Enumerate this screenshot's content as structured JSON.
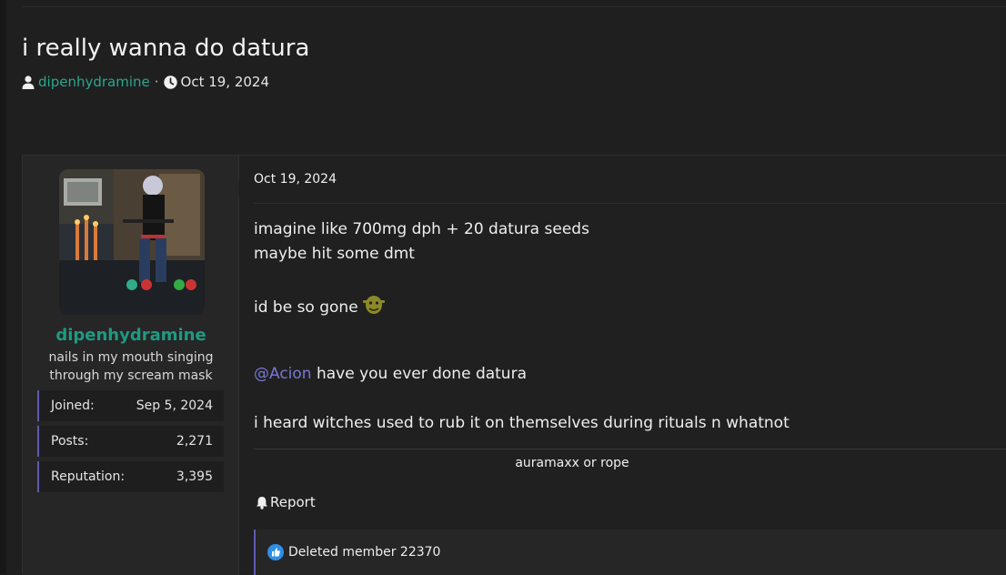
{
  "thread": {
    "title": "i really wanna do datura",
    "author": "dipenhydramine",
    "separator": "·",
    "date": "Oct 19, 2024",
    "icons": {
      "author": "user-icon",
      "date": "clock-icon"
    }
  },
  "post": {
    "user": {
      "username": "dipenhydramine",
      "title": "nails in my mouth singing through my scream mask",
      "avatar": "avatar",
      "stats": [
        {
          "label": "Joined:",
          "value": "Sep 5, 2024"
        },
        {
          "label": "Posts:",
          "value": "2,271"
        },
        {
          "label": "Reputation:",
          "value": "3,395"
        }
      ]
    },
    "date": "Oct 19, 2024",
    "body": {
      "line1": "imagine like 700mg dph + 20 datura seeds",
      "line2": "maybe hit some dmt",
      "line3": "id be so gone",
      "emoji": "shrek-emoji",
      "mention": "@Acion",
      "line4": " have you ever done datura",
      "line5": "i heard witches used to rub it on themselves during rituals n whatnot"
    },
    "signature": "auramaxx or rope",
    "actions": {
      "report": "Report",
      "report_icon": "bell-icon"
    },
    "reactions": {
      "icon": "like-icon",
      "text": "Deleted member 22370"
    }
  },
  "colors": {
    "background": "#1f1f1f",
    "accent_green": "#1e9a82",
    "mention": "#7a77d6",
    "stat_border": "#5e5ab0",
    "like_blue": "#2f8fe8"
  }
}
